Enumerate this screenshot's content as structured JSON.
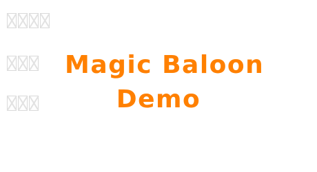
{
  "preview": {
    "text_line_1": "Magic Baloon",
    "text_line_2": "Demo",
    "text_color": "#ff8000"
  },
  "missing_glyph_rows": [
    {
      "count": 4
    },
    {
      "count": 3
    },
    {
      "count": 3
    }
  ]
}
